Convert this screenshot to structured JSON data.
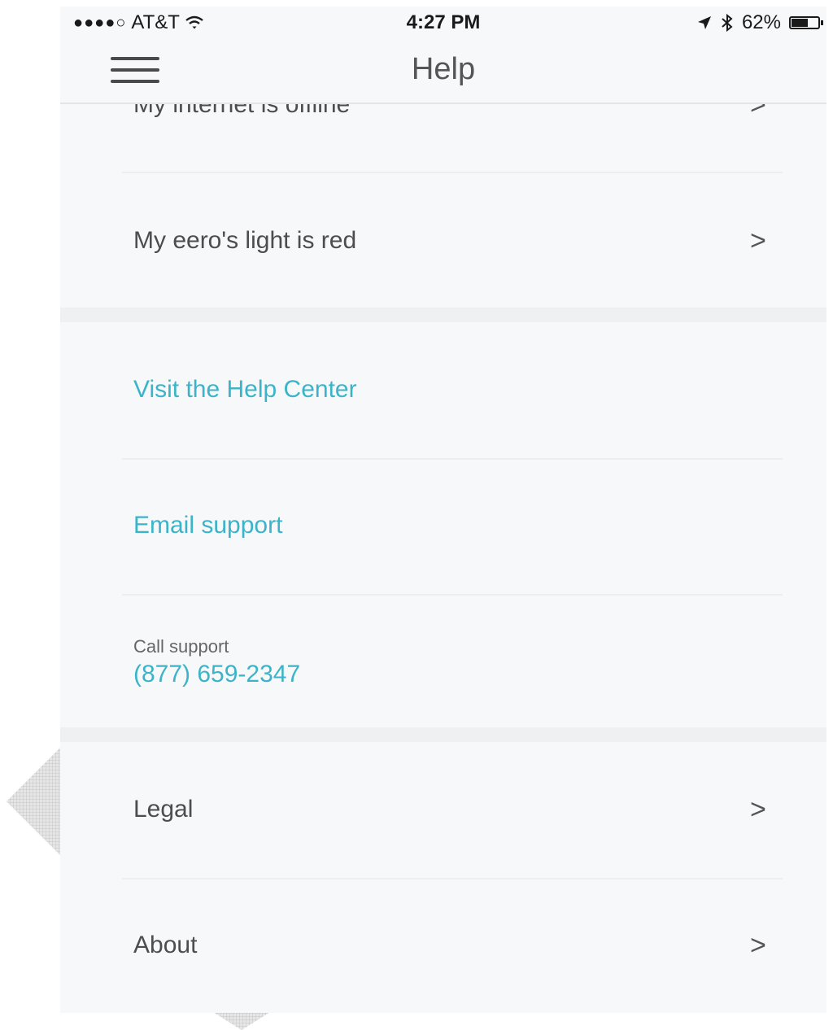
{
  "status_bar": {
    "signal": "●●●●○",
    "carrier": "AT&T",
    "time": "4:27 PM",
    "battery_percent": "62%",
    "battery_level": 0.62
  },
  "nav": {
    "title": "Help"
  },
  "items": {
    "internet_offline": "My internet is offline",
    "eero_light_red": "My eero's light is red",
    "help_center": "Visit the Help Center",
    "email_support": "Email support",
    "call_support_label": "Call support",
    "call_support_number": "(877) 659-2347",
    "legal": "Legal",
    "about": "About"
  },
  "chevron": ">",
  "colors": {
    "accent": "#3bb4c9",
    "background": "#f7f8fa"
  }
}
